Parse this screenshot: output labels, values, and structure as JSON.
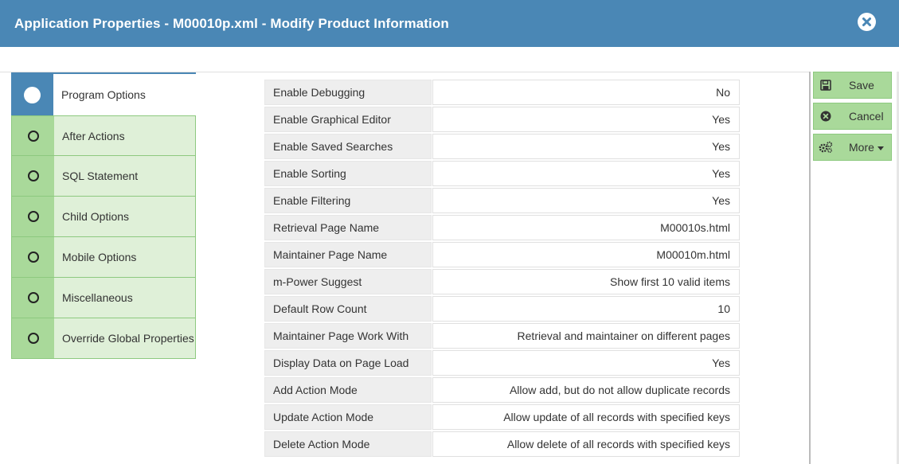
{
  "header": {
    "title": "Application Properties - M00010p.xml - Modify Product Information"
  },
  "nav": {
    "items": [
      {
        "label": "Program Options",
        "active": true
      },
      {
        "label": "After Actions"
      },
      {
        "label": "SQL Statement"
      },
      {
        "label": "Child Options"
      },
      {
        "label": "Mobile Options"
      },
      {
        "label": "Miscellaneous"
      },
      {
        "label": "Override Global Properties"
      }
    ]
  },
  "properties": [
    {
      "key": "Enable Debugging",
      "value": "No"
    },
    {
      "key": "Enable Graphical Editor",
      "value": "Yes"
    },
    {
      "key": "Enable Saved Searches",
      "value": "Yes"
    },
    {
      "key": "Enable Sorting",
      "value": "Yes"
    },
    {
      "key": "Enable Filtering",
      "value": "Yes"
    },
    {
      "key": "Retrieval Page Name",
      "value": "M00010s.html"
    },
    {
      "key": "Maintainer Page Name",
      "value": "M00010m.html"
    },
    {
      "key": "m-Power Suggest",
      "value": "Show first 10 valid items"
    },
    {
      "key": "Default Row Count",
      "value": "10"
    },
    {
      "key": "Maintainer Page Work With",
      "value": "Retrieval and maintainer on different pages"
    },
    {
      "key": "Display Data on Page Load",
      "value": "Yes"
    },
    {
      "key": "Add Action Mode",
      "value": "Allow add, but do not allow duplicate records"
    },
    {
      "key": "Update Action Mode",
      "value": "Allow update of all records with specified keys"
    },
    {
      "key": "Delete Action Mode",
      "value": "Allow delete of all records with specified keys"
    }
  ],
  "actions": {
    "save_label": "Save",
    "cancel_label": "Cancel",
    "more_label": "More"
  },
  "icons": {
    "close": "close-circle-icon",
    "save": "floppy-disk-icon",
    "cancel": "times-circle-icon",
    "more": "gears-icon"
  },
  "colors": {
    "header": "#4a87b5",
    "nav_active": "#4a87b5",
    "nav_indicator": "#a9d99a",
    "nav_bg": "#dff0d8",
    "button": "#a9d99a"
  }
}
